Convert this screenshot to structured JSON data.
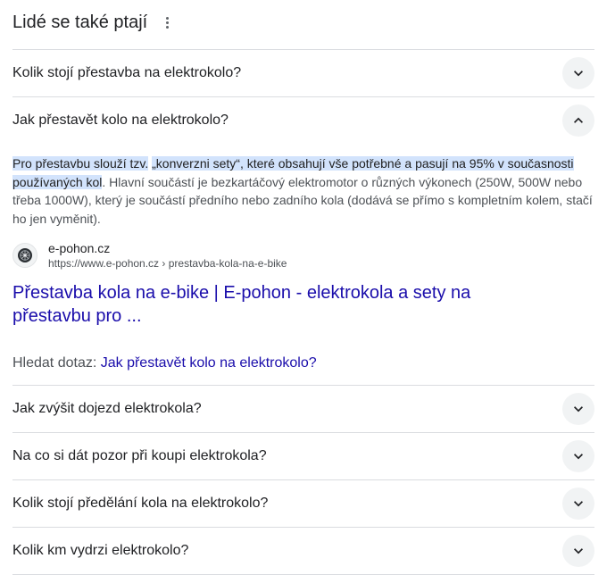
{
  "header": {
    "title": "Lidé se také ptají"
  },
  "questions_before": [
    {
      "text": "Kolik stojí přestavba na elektrokolo?"
    }
  ],
  "open_question": {
    "text": "Jak přestavět kolo na elektrokolo?",
    "answer": {
      "highlight_1": "Pro přestavbu slouží tzv.",
      "highlight_2": "„konverzni sety“, které obsahují vše potřebné a pasují na 95% v současnosti používaných kol",
      "rest": ". Hlavní součástí je bezkartáčový elektromotor o různých výkonech (250W, 500W nebo třeba 1000W), který je součástí předního nebo zadního kola (dodává se přímo s kompletním kolem, stačí ho jen vyměnit)."
    },
    "source": {
      "site_name": "e-pohon.cz",
      "url": "https://www.e-pohon.cz › prestavba-kola-na-e-bike",
      "title": "Přestavba kola na e-bike | E-pohon - elektrokola a sety na přestavbu pro ..."
    },
    "search": {
      "label": "Hledat dotaz:",
      "query": "Jak přestavět kolo na elektrokolo?"
    }
  },
  "questions_after": [
    {
      "text": "Jak zvýšit dojezd elektrokola?"
    },
    {
      "text": "Na co si dát pozor při koupi elektrokola?"
    },
    {
      "text": "Kolik stojí předělání kola na elektrokolo?"
    },
    {
      "text": "Kolik km vydrzi elektrokolo?"
    }
  ],
  "icons": {
    "more": "more-vert-icon",
    "expand": "chevron-down-icon",
    "collapse": "chevron-up-icon",
    "favicon": "site-favicon-icon"
  },
  "colors": {
    "link": "#1a0dab",
    "highlight": "#d2e3fc",
    "chevron_bg": "#f1f3f4",
    "divider": "#dadce0"
  }
}
